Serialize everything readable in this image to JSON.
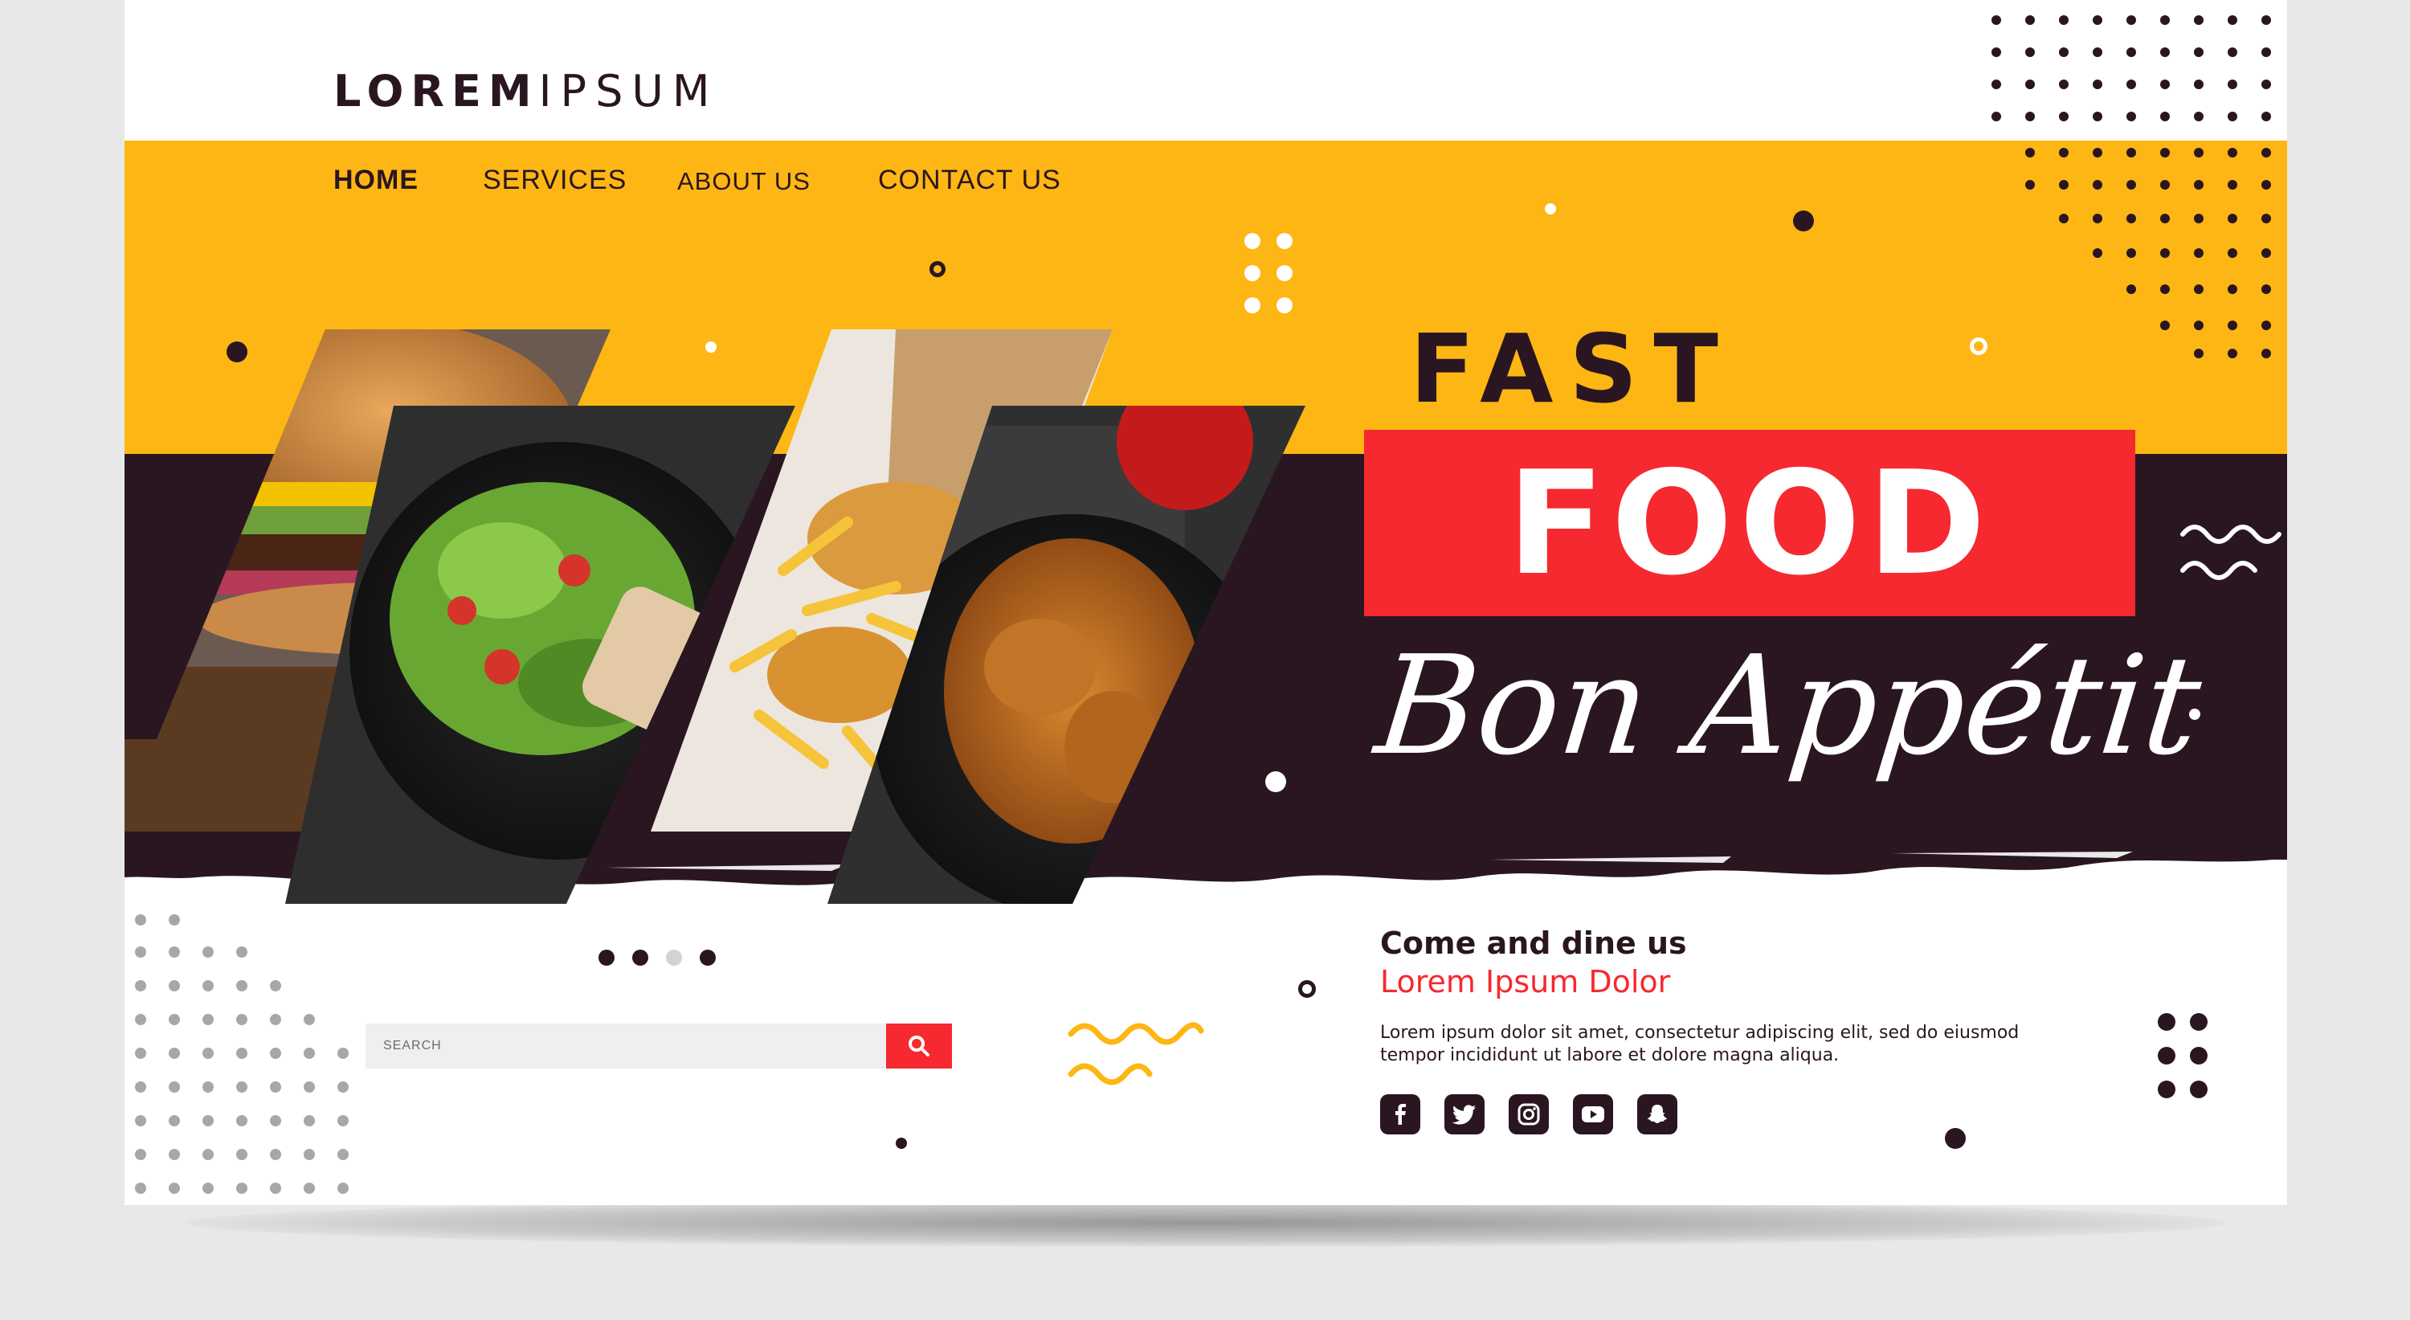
{
  "brand": {
    "bold": "LOREM",
    "light": "IPSUM"
  },
  "nav": {
    "home": "HOME",
    "services": "SERVICES",
    "about": "ABOUT US",
    "contact": "CONTACT US"
  },
  "hero": {
    "line1": "FAST",
    "line2": "FOOD",
    "script": "Bon Appétit"
  },
  "search": {
    "placeholder": "SEARCH",
    "button_icon": "search-icon"
  },
  "slider": {
    "count": 4,
    "active_index": 2
  },
  "info": {
    "heading": "Come and dine us",
    "subheading": "Lorem Ipsum Dolor",
    "body": "Lorem ipsum dolor sit amet, consectetur adipiscing elit, sed do eiusmod tempor incididunt ut labore et dolore magna aliqua."
  },
  "socials": [
    "facebook-icon",
    "twitter-icon",
    "instagram-icon",
    "youtube-icon",
    "snapchat-icon"
  ],
  "colors": {
    "yellow": "#fdb613",
    "dark": "#2a1620",
    "red": "#f5292f",
    "white": "#ffffff",
    "gray_dot": "#aaa5a8"
  }
}
